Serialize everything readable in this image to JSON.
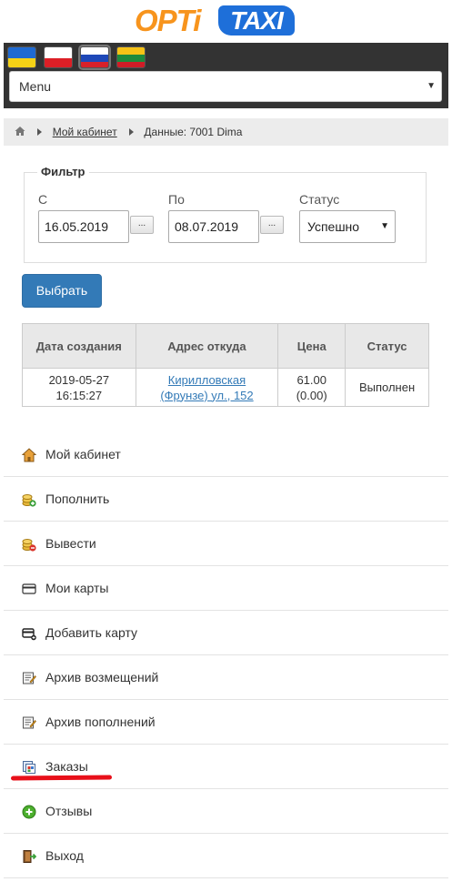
{
  "logo": {
    "part1": "OPTi",
    "part2": "TAXI"
  },
  "languages": [
    {
      "code": "ua",
      "colors": [
        "#1f6ad1",
        "#f5d216"
      ]
    },
    {
      "code": "pl",
      "colors": [
        "#ffffff",
        "#dc1f26"
      ]
    },
    {
      "code": "ru",
      "colors": [
        "#ffffff",
        "#1e48b8",
        "#d8212a"
      ],
      "active": true
    },
    {
      "code": "lt",
      "colors": [
        "#f6c216",
        "#1e8a3c",
        "#d01d27"
      ]
    }
  ],
  "menu": {
    "label": "Menu"
  },
  "breadcrumb": {
    "home_icon": "home-icon",
    "cabinet": "Мой кабинет",
    "current": "Данные: 7001 Dima"
  },
  "filter": {
    "legend": "Фильтр",
    "from_label": "С",
    "from_value": "16.05.2019",
    "to_label": "По",
    "to_value": "08.07.2019",
    "picker_label": "...",
    "status_label": "Статус",
    "status_value": "Успешно",
    "submit": "Выбрать"
  },
  "table": {
    "headers": [
      "Дата создания",
      "Адрес откуда",
      "Цена",
      "Статус"
    ],
    "rows": [
      {
        "date": "2019-05-27",
        "time": "16:15:27",
        "address_line1": "Кирилловская",
        "address_line2": "(Фрунзе) ул., 152",
        "price": "61.00",
        "price_extra": "(0.00)",
        "status": "Выполнен"
      }
    ]
  },
  "side_menu": [
    {
      "label": "Мой кабинет",
      "icon": "home-icon"
    },
    {
      "label": "Пополнить",
      "icon": "coins-add-icon"
    },
    {
      "label": "Вывести",
      "icon": "coins-remove-icon"
    },
    {
      "label": "Мои карты",
      "icon": "card-icon"
    },
    {
      "label": "Добавить карту",
      "icon": "card-add-icon"
    },
    {
      "label": "Архив возмещений",
      "icon": "archive-edit-icon"
    },
    {
      "label": "Архив пополнений",
      "icon": "archive-edit-icon"
    },
    {
      "label": "Заказы",
      "icon": "orders-icon"
    },
    {
      "label": "Отзывы",
      "icon": "plus-circle-icon"
    },
    {
      "label": "Выход",
      "icon": "exit-door-icon"
    }
  ],
  "colors": {
    "accent": "#337ab7",
    "logo_orange": "#f7941d",
    "logo_blue": "#1e6fd9",
    "highlight": "#e8101a"
  }
}
